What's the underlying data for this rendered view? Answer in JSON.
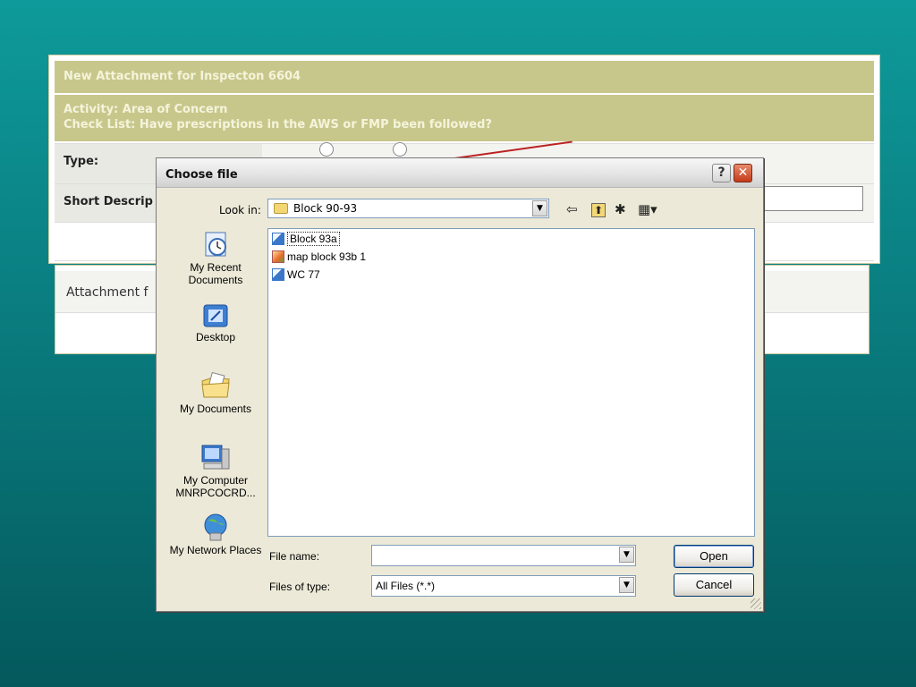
{
  "form": {
    "title": "New Attachment for Inspecton 6604",
    "activity_line": "Activity: Area of Concern",
    "checklist_line": "Check List: Have prescriptions in the AWS or FMP been followed?",
    "type_label": "Type:",
    "short_desc_label": "Short Descrip"
  },
  "attachment": {
    "label": "Attachment f"
  },
  "dialog": {
    "title": "Choose file",
    "help_label": "?",
    "close_label": "✕",
    "look_in_label": "Look in:",
    "look_in_value": "Block 90-93",
    "toolbar": {
      "back": "⇦",
      "up": "⬆",
      "new_folder": "✱",
      "view": "▦▾"
    },
    "places": [
      {
        "label": "My Recent Documents",
        "icon": "recent-documents-icon"
      },
      {
        "label": "Desktop",
        "icon": "desktop-icon"
      },
      {
        "label": "My Documents",
        "icon": "my-documents-icon"
      },
      {
        "label": "My Computer MNRPCOCRD...",
        "icon": "my-computer-icon"
      },
      {
        "label": "My Network Places",
        "icon": "network-places-icon"
      }
    ],
    "files": [
      {
        "name": "Block 93a",
        "icon": "shortcut-icon",
        "selected": true
      },
      {
        "name": "map block 93b 1",
        "icon": "image-file-icon",
        "selected": false
      },
      {
        "name": "WC 77",
        "icon": "shortcut-icon",
        "selected": false
      }
    ],
    "file_name_label": "File name:",
    "file_name_value": "",
    "file_type_label": "Files of type:",
    "file_type_value": "All Files (*.*)",
    "open_button": "Open",
    "cancel_button": "Cancel"
  }
}
